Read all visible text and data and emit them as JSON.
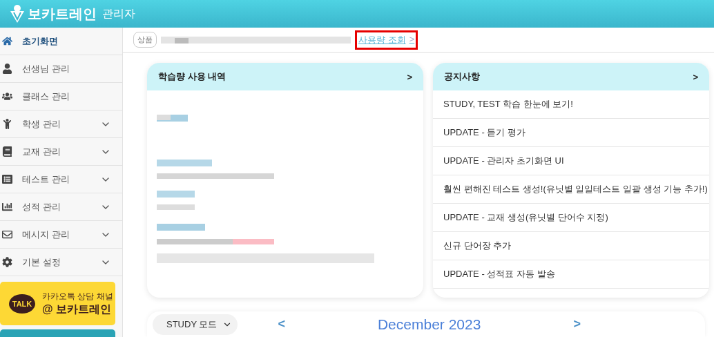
{
  "header": {
    "brand": "보카트레인",
    "subtitle": "관리자"
  },
  "sidebar": {
    "items": [
      {
        "label": "초기화면",
        "selected": true,
        "kind": "link"
      },
      {
        "label": "선생님 관리",
        "selected": false,
        "kind": "link"
      },
      {
        "label": "클래스 관리",
        "selected": false,
        "kind": "link"
      },
      {
        "label": "학생 관리",
        "selected": false,
        "kind": "group"
      },
      {
        "label": "교재 관리",
        "selected": false,
        "kind": "group"
      },
      {
        "label": "테스트 관리",
        "selected": false,
        "kind": "group"
      },
      {
        "label": "성적 관리",
        "selected": false,
        "kind": "group"
      },
      {
        "label": "메시지 관리",
        "selected": false,
        "kind": "group"
      },
      {
        "label": "기본 설정",
        "selected": false,
        "kind": "group"
      }
    ],
    "kakao": {
      "badge": "TALK",
      "line1": "카카오톡 상담 채널",
      "line2": "@ 보카트레인"
    }
  },
  "topbar": {
    "badge": "상품",
    "link": "사용량 조회",
    "link_arrow": ">",
    "highlighted": true
  },
  "usage_card": {
    "title": "학습량 사용 내역",
    "arrow": ">"
  },
  "notice_card": {
    "title": "공지사항",
    "arrow": ">",
    "items": [
      "STUDY, TEST 학습 한눈에 보기!",
      "UPDATE - 듣기 평가",
      "UPDATE - 관리자 초기화면 UI",
      "훨씬 편해진 테스트 생성!(유닛별 일일테스트 일괄 생성 기능 추가!)",
      "UPDATE - 교재 생성(유닛별 단어수 지정)",
      "신규 단어장 추가",
      "UPDATE - 성적표 자동 발송"
    ]
  },
  "calendar": {
    "mode": "STUDY 모드",
    "prev": "<",
    "month": "December 2023",
    "next": ">"
  }
}
